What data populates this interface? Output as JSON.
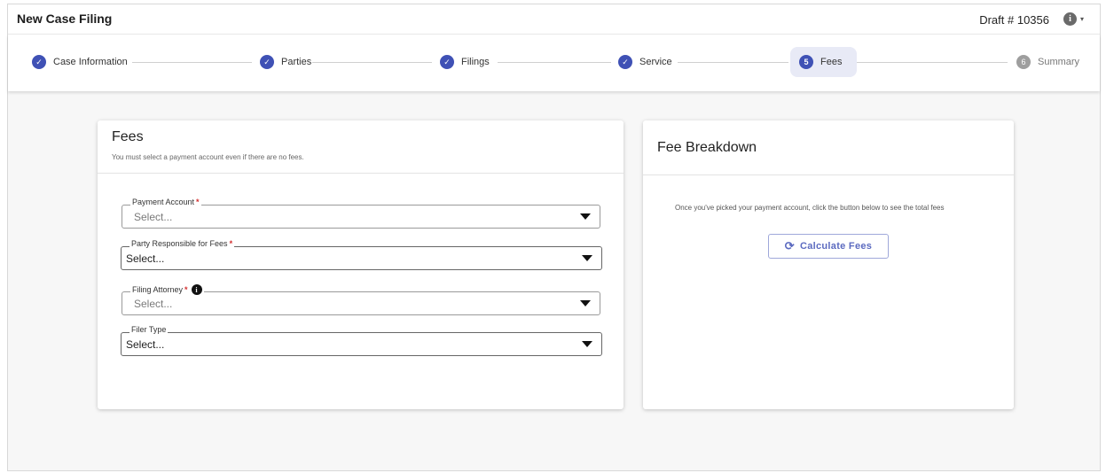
{
  "header": {
    "title": "New Case Filing",
    "draft": "Draft # 10356",
    "info_icon": "i",
    "caret": "▾"
  },
  "stepper": {
    "steps": [
      {
        "label": "Case Information",
        "status": "done"
      },
      {
        "label": "Parties",
        "status": "done"
      },
      {
        "label": "Filings",
        "status": "done"
      },
      {
        "label": "Service",
        "status": "done"
      },
      {
        "label": "Fees",
        "number": "5",
        "status": "active"
      },
      {
        "label": "Summary",
        "number": "6",
        "status": "todo"
      }
    ],
    "check": "✓"
  },
  "fees_card": {
    "title": "Fees",
    "subtitle": "You must select a payment account even if there are no fees.",
    "required_mark": "*",
    "fields": [
      {
        "label": "Payment Account",
        "value": "Select..."
      },
      {
        "label": "Party Responsible for Fees",
        "value": "Select..."
      },
      {
        "label": "Filing Attorney",
        "value": "Select..."
      },
      {
        "label": "Filer Type",
        "value": "Select..."
      }
    ]
  },
  "breakdown_card": {
    "title": "Fee Breakdown",
    "description": "Once you've picked your payment account, click the button below to see the total fees",
    "button_label": "Calculate Fees",
    "button_icon": "⟳"
  },
  "colors": {
    "accent": "#3f51b5",
    "active_step_bg": "#e8eaf6",
    "required": "#d32f2f"
  }
}
